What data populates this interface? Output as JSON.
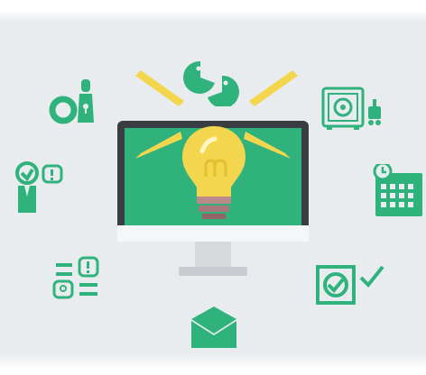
{
  "scene": {
    "background_color": "#e9ecef",
    "accent_color": "#2fb27c",
    "bulb_color": "#f3d64e",
    "monitor_frame_color": "#3a3d42",
    "monitor_stand_color": "#d7dadd",
    "icons": [
      "pacman-pair-icon",
      "light-rays-icon",
      "lightbulb-icon",
      "key-lock-icon",
      "safe-icon",
      "person-question-icon",
      "calendar-icon",
      "faq-chat-icon",
      "checkbox-check-icon",
      "envelope-icon"
    ]
  }
}
